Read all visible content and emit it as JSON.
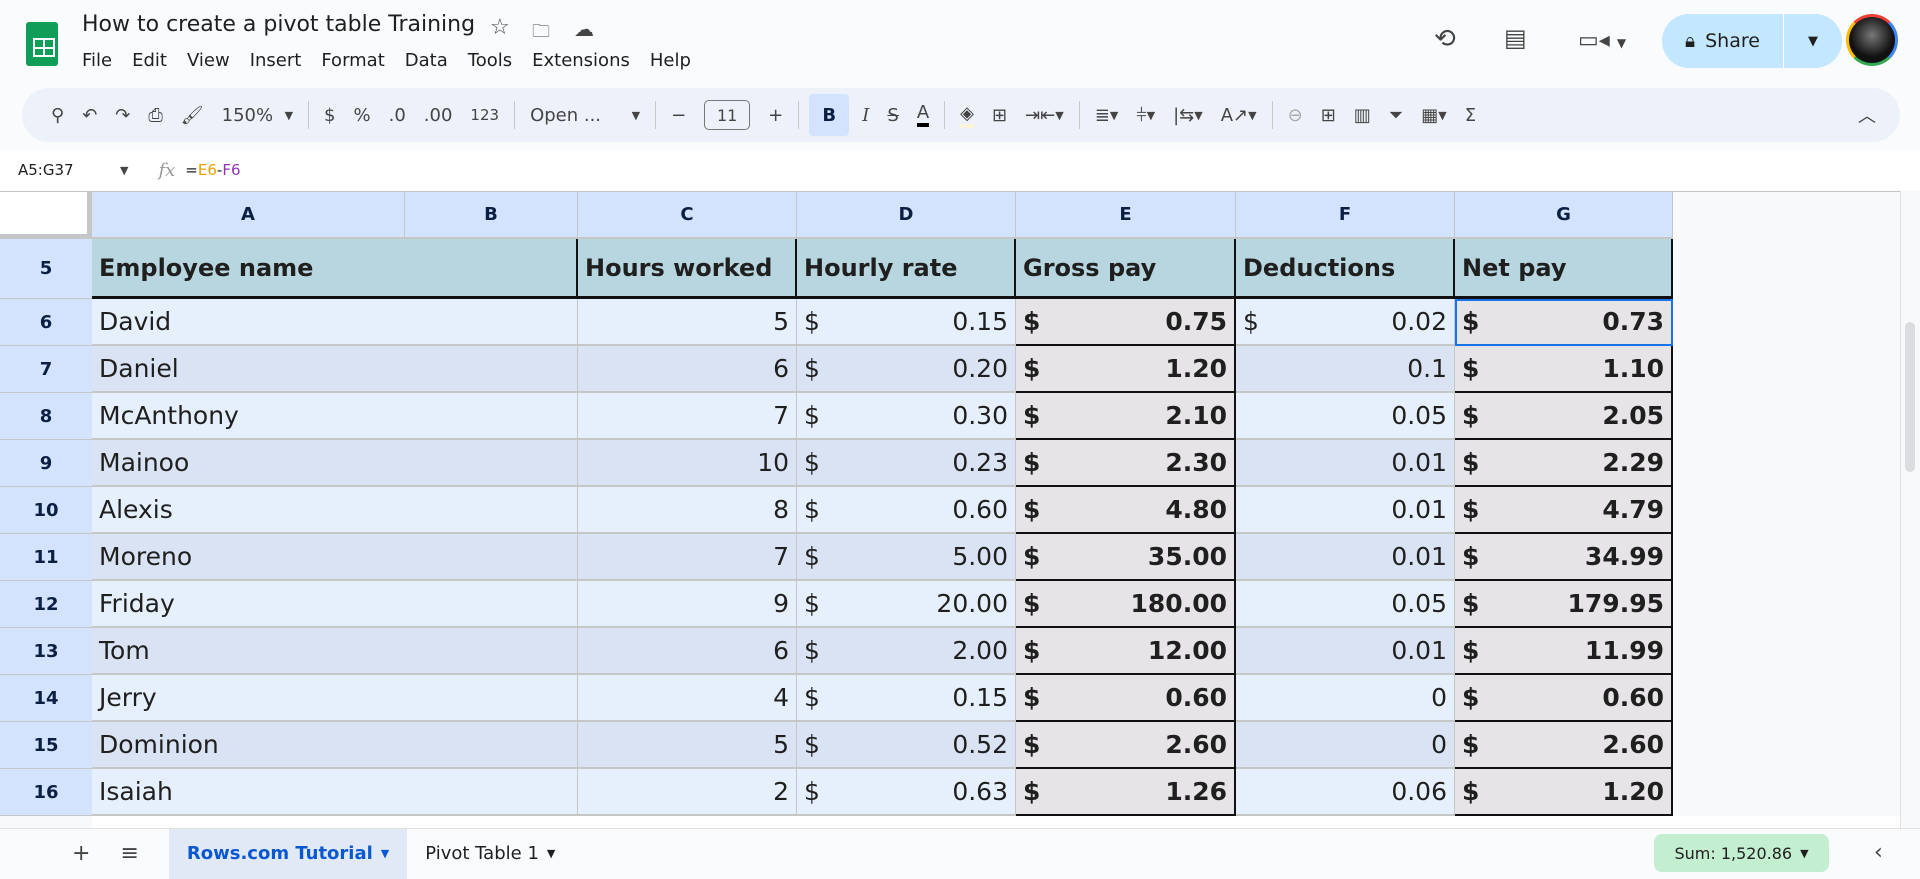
{
  "app": {
    "title": "How to create a pivot table Training",
    "icons": [
      "star-icon",
      "move-folder-icon",
      "cloud-saved-icon"
    ]
  },
  "menu": [
    "File",
    "Edit",
    "View",
    "Insert",
    "Format",
    "Data",
    "Tools",
    "Extensions",
    "Help"
  ],
  "header_right": {
    "share_label": "Share",
    "icons": [
      "history-icon",
      "comment-icon",
      "meet-icon",
      "lock-icon",
      "avatar"
    ]
  },
  "toolbar": {
    "zoom": "150%",
    "font": "Open ...",
    "font_size": "11",
    "currency": "$",
    "percent": "%",
    "dec_decrease": ".0",
    "dec_increase": ".00",
    "number_format": "123",
    "bold": "B",
    "italic": "I",
    "sigma": "Σ",
    "fill_color": "#fdf3d8",
    "text_color": "#000000"
  },
  "formula_bar": {
    "name_box": "A5:G37",
    "fx": "fx",
    "formula_eq": "=",
    "ref1": "E6",
    "minus": "-",
    "ref2": "F6",
    "ref1_color": "#e8a000",
    "ref2_color": "#9334b5"
  },
  "columns": [
    "A",
    "B",
    "C",
    "D",
    "E",
    "F",
    "G"
  ],
  "header_row": {
    "row": "5",
    "cells": [
      "Employee name",
      "Hours worked",
      "Hourly rate",
      "Gross pay",
      "Deductions",
      "Net pay"
    ]
  },
  "rows": [
    {
      "row": "6",
      "name": "David",
      "hours": "5",
      "rate": "0.15",
      "gross": "0.75",
      "ded": "0.02",
      "ded_dollar": "$",
      "net": "0.73"
    },
    {
      "row": "7",
      "name": "Daniel",
      "hours": "6",
      "rate": "0.20",
      "gross": "1.20",
      "ded": "0.1",
      "net": "1.10"
    },
    {
      "row": "8",
      "name": "McAnthony",
      "hours": "7",
      "rate": "0.30",
      "gross": "2.10",
      "ded": "0.05",
      "net": "2.05"
    },
    {
      "row": "9",
      "name": "Mainoo",
      "hours": "10",
      "rate": "0.23",
      "gross": "2.30",
      "ded": "0.01",
      "net": "2.29"
    },
    {
      "row": "10",
      "name": "Alexis",
      "hours": "8",
      "rate": "0.60",
      "gross": "4.80",
      "ded": "0.01",
      "net": "4.79"
    },
    {
      "row": "11",
      "name": "Moreno",
      "hours": "7",
      "rate": "5.00",
      "gross": "35.00",
      "ded": "0.01",
      "net": "34.99"
    },
    {
      "row": "12",
      "name": "Friday",
      "hours": "9",
      "rate": "20.00",
      "gross": "180.00",
      "ded": "0.05",
      "net": "179.95"
    },
    {
      "row": "13",
      "name": "Tom",
      "hours": "6",
      "rate": "2.00",
      "gross": "12.00",
      "ded": "0.01",
      "net": "11.99"
    },
    {
      "row": "14",
      "name": "Jerry",
      "hours": "4",
      "rate": "0.15",
      "gross": "0.60",
      "ded": "0",
      "net": "0.60"
    },
    {
      "row": "15",
      "name": "Dominion",
      "hours": "5",
      "rate": "0.52",
      "gross": "2.60",
      "ded": "0",
      "net": "2.60"
    },
    {
      "row": "16",
      "name": "Isaiah",
      "hours": "2",
      "rate": "0.63",
      "gross": "1.26",
      "ded": "0.06",
      "net": "1.20"
    }
  ],
  "currency_symbol": "$",
  "sheets": [
    {
      "label": "Rows.com Tutorial",
      "active": true
    },
    {
      "label": "Pivot Table 1",
      "active": false
    }
  ],
  "status": {
    "sum": "Sum: 1,520.86"
  }
}
